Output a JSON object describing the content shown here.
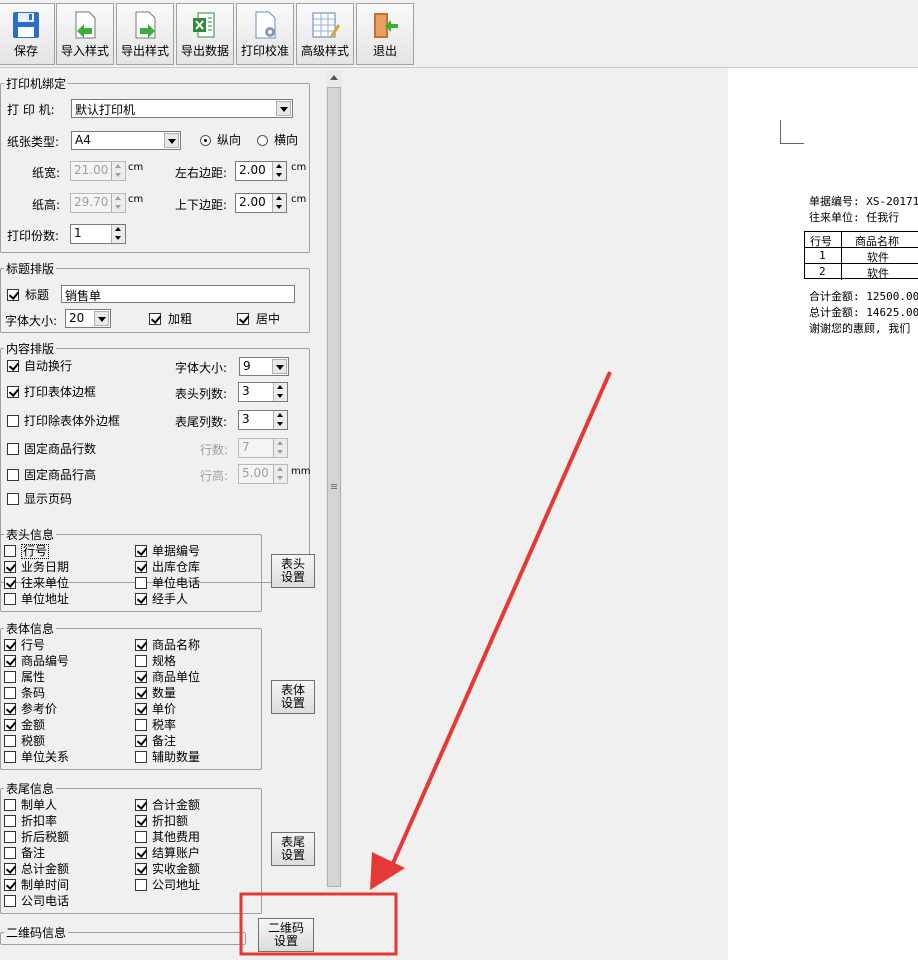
{
  "toolbar": {
    "save": "保存",
    "import_style": "导入样式",
    "export_style": "导出样式",
    "export_data": "导出数据",
    "print_calib": "打印校准",
    "advanced_style": "高级样式",
    "exit": "退出"
  },
  "printer_binding": {
    "legend": "打印机绑定",
    "printer_label": "打 印 机:",
    "printer_value": "默认打印机",
    "paper_type_label": "纸张类型:",
    "paper_type_value": "A4",
    "portrait": "纵向",
    "landscape": "横向",
    "paper_width_label": "纸宽:",
    "paper_width_value": "21.00",
    "paper_height_label": "纸高:",
    "paper_height_value": "29.70",
    "unit_cm": "cm",
    "lr_margin_label": "左右边距:",
    "lr_margin_value": "2.00",
    "tb_margin_label": "上下边距:",
    "tb_margin_value": "2.00",
    "copies_label": "打印份数:",
    "copies_value": "1"
  },
  "title_layout": {
    "legend": "标题排版",
    "title_label": "标题",
    "title_value": "销售单",
    "font_size_label": "字体大小:",
    "font_size_value": "20",
    "bold": "加粗",
    "center": "居中"
  },
  "content_layout": {
    "legend": "内容排版",
    "auto_wrap": "自动换行",
    "print_table_border": "打印表体边框",
    "print_inner_border": "打印除表体外边框",
    "fixed_rows": "固定商品行数",
    "fixed_row_height": "固定商品行高",
    "show_page_no": "显示页码",
    "font_size_label": "字体大小:",
    "font_size_value": "9",
    "header_cols_label": "表头列数:",
    "header_cols_value": "3",
    "footer_cols_label": "表尾列数:",
    "footer_cols_value": "3",
    "rows_label": "行数:",
    "rows_value": "7",
    "row_height_label": "行高:",
    "row_height_value": "5.00",
    "unit_mm": "mm"
  },
  "header_info": {
    "legend": "表头信息",
    "items": [
      "行号",
      "单据编号",
      "业务日期",
      "出库仓库",
      "往来单位",
      "单位电话",
      "单位地址",
      "经手人"
    ],
    "settings_line1": "表头",
    "settings_line2": "设置"
  },
  "body_info": {
    "legend": "表体信息",
    "items": [
      "行号",
      "商品名称",
      "商品编号",
      "规格",
      "属性",
      "商品单位",
      "条码",
      "数量",
      "参考价",
      "单价",
      "金额",
      "税率",
      "税额",
      "备注",
      "单位关系",
      "辅助数量"
    ],
    "settings_line1": "表体",
    "settings_line2": "设置"
  },
  "footer_info": {
    "legend": "表尾信息",
    "items": [
      "制单人",
      "合计金额",
      "折扣率",
      "折扣额",
      "折后税额",
      "其他费用",
      "备注",
      "结算账户",
      "总计金额",
      "实收金额",
      "制单时间",
      "公司地址",
      "公司电话"
    ],
    "settings_line1": "表尾",
    "settings_line2": "设置"
  },
  "qr_info": {
    "legend": "二维码信息",
    "settings_line1": "二维码",
    "settings_line2": "设置"
  },
  "preview": {
    "doc_no": "单据编号: XS-20171",
    "partner": "往来单位: 任我行",
    "col_no": "行号",
    "col_name": "商品名称",
    "row1_no": "1",
    "row1_name": "软件",
    "row2_no": "2",
    "row2_name": "软件",
    "sum_amount": "合计金额: 12500.00",
    "total_amount": "总计金额: 14625.00",
    "thanks": "谢谢您的惠顾, 我们"
  },
  "colors": {
    "annotation": "#e53935"
  }
}
